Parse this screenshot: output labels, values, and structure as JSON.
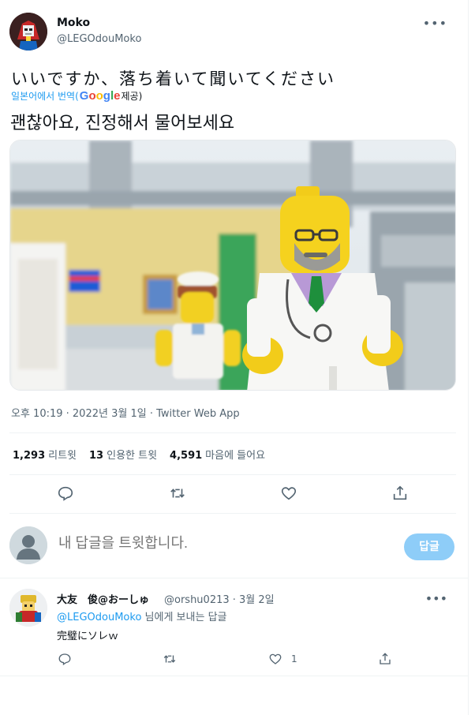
{
  "tweet": {
    "display_name": "Moko",
    "handle": "@LEGOdouMoko",
    "more_icon": "ellipsis-icon",
    "text_original": "いいですか、落ち着いて聞いてください",
    "translated_by_prefix": "일본어에서 번역(",
    "translated_by_brand": "Google",
    "translated_by_suffix": " 제공)",
    "text_translated": "괜찮아요, 진정해서 물어보세요",
    "timestamp": "오후 10:19 · 2022년 3월 1일 · Twitter Web App",
    "stats": {
      "retweets_count": "1,293",
      "retweets_label": "리트윗",
      "quotes_count": "13",
      "quotes_label": "인용한 트윗",
      "likes_count": "4,591",
      "likes_label": "마음에 들어요"
    },
    "actions": [
      "reply-icon",
      "retweet-icon",
      "like-icon",
      "share-icon"
    ]
  },
  "compose": {
    "placeholder": "내 답글을 트윗합니다.",
    "button_label": "답글"
  },
  "reply": {
    "display_name": "大友　俊@おーしゅ",
    "handle_date": "@orshu0213 · 3월 2일",
    "replying_mention": "@LEGOdouMoko",
    "replying_suffix": " 님에게 보내는 답글",
    "text": "完璧にソレｗ",
    "like_count": "1"
  },
  "colors": {
    "accent": "#1d9bf0",
    "secondary_text": "#536471",
    "divider": "#eff3f4",
    "reply_button_disabled": "#8ecdf8"
  }
}
